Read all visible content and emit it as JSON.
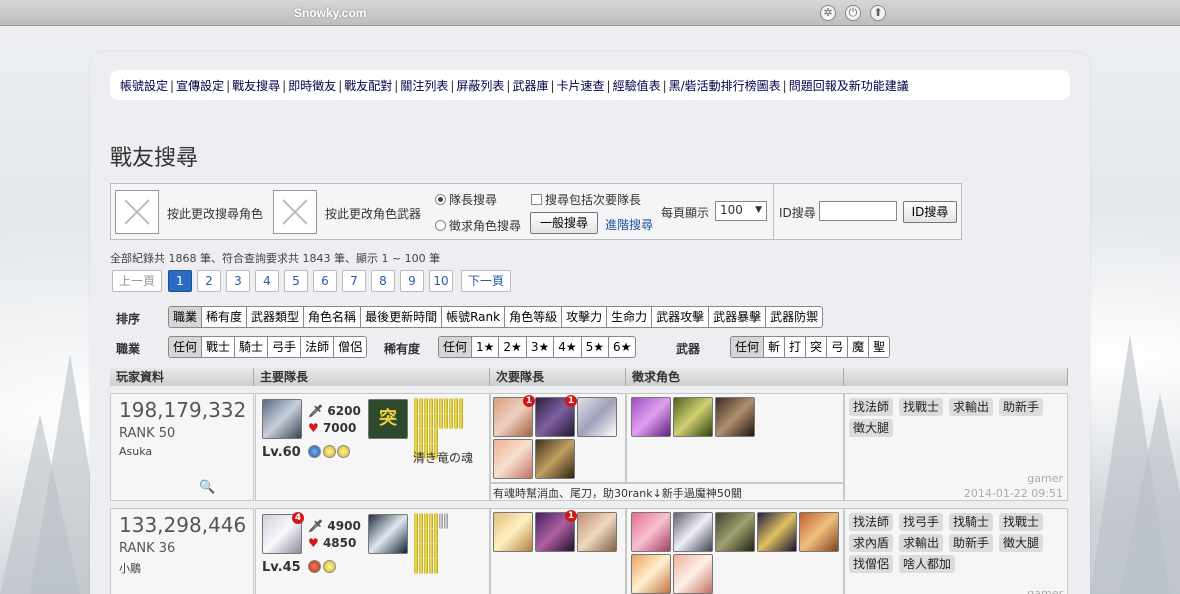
{
  "topbar": {
    "site": "Snowky.com"
  },
  "nav": [
    "帳號設定",
    "宣傳設定",
    "戰友搜尋",
    "即時徵友",
    "戰友配對",
    "關注列表",
    "屏蔽列表",
    "武器庫",
    "卡片速查",
    "經驗值表",
    "黑/砦活動排行榜圖表",
    "問題回報及新功能建議"
  ],
  "page_title": "戰友搜尋",
  "search": {
    "change_char": "按此更改搜尋角色",
    "change_weapon": "按此更改角色武器",
    "radio_leader": "隊長搜尋",
    "radio_recruit": "徵求角色搜尋",
    "check_secondary": "搜尋包括次要隊長",
    "general_btn": "一般搜尋",
    "advanced_link": "進階搜尋",
    "per_page_label": "每頁顯示",
    "per_page_value": "100",
    "id_label": "ID搜尋",
    "id_btn": "ID搜尋"
  },
  "summary": "全部紀錄共 1868 筆、符合查詢要求共 1843 筆、顯示 1 ~ 100 筆",
  "pager": {
    "prev": "上一頁",
    "next": "下一頁",
    "pages": [
      "1",
      "2",
      "3",
      "4",
      "5",
      "6",
      "7",
      "8",
      "9",
      "10"
    ],
    "current": "1"
  },
  "sort": {
    "label": "排序",
    "options": [
      "職業",
      "稀有度",
      "武器類型",
      "角色名稱",
      "最後更新時間",
      "帳號Rank",
      "角色等級",
      "攻擊力",
      "生命力",
      "武器攻擊",
      "武器暴擊",
      "武器防禦"
    ]
  },
  "filters": {
    "job_label": "職業",
    "jobs": [
      "任何",
      "戰士",
      "騎士",
      "弓手",
      "法師",
      "僧侶"
    ],
    "rarity_label": "稀有度",
    "rarities": [
      "任何",
      "1★",
      "2★",
      "3★",
      "4★",
      "5★",
      "6★"
    ],
    "weapon_label": "武器",
    "weapons": [
      "任何",
      "斬",
      "打",
      "突",
      "弓",
      "魔",
      "聖"
    ]
  },
  "table": {
    "headers": [
      "玩家資料",
      "主要隊長",
      "次要隊長",
      "徵求角色",
      ""
    ],
    "rows": [
      {
        "account_id": "198,179,332",
        "rank": "RANK 50",
        "name": "Asuka",
        "atk": "6200",
        "hp": "7000",
        "level": "Lv.60",
        "weapon_glyph": "突",
        "soul": "清き竜の魂",
        "secondary_badges": [
          "1",
          "1"
        ],
        "note": "有魂時幫消血、尾刀，助30rank↓新手過魔神50關",
        "tags": [
          "找法師",
          "找戰士",
          "求輸出",
          "助新手",
          "徵大腿"
        ],
        "user": "gamer",
        "time": "2014-01-22 09:51"
      },
      {
        "account_id": "133,298,446",
        "rank": "RANK 36",
        "name": "小鵰",
        "atk": "4900",
        "hp": "4850",
        "level": "Lv.45",
        "leader_badge": "4",
        "secondary_badges": [
          "1"
        ],
        "tags": [
          "找法師",
          "找弓手",
          "找騎士",
          "找戰士",
          "求內盾",
          "求輸出",
          "助新手",
          "徵大腿",
          "找僧侶",
          "啥人都加"
        ],
        "user": "gamer"
      }
    ]
  },
  "colors": {
    "accent": "#2a6cc4",
    "badge": "#d01818"
  }
}
